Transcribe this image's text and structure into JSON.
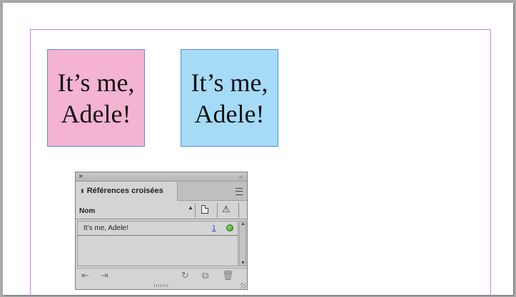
{
  "frames": {
    "pink": {
      "line1": "It’s me,",
      "line2": "Adele!",
      "color": "#f4b3d3"
    },
    "blue": {
      "line1": "It’s me,",
      "line2": "Adele!",
      "color": "#a6dbf7"
    }
  },
  "panel": {
    "close_icon": "×",
    "collapse_icon": "‹‹",
    "tab_label": "Références croisées",
    "tab_arrows": "⬍",
    "columns": {
      "name": "Nom",
      "sort_icon": "▲",
      "page_icon": "page-icon",
      "warning_icon": "⚠"
    },
    "rows": [
      {
        "name": "It’s me, Adele!",
        "page": "1",
        "status": "ok",
        "status_color": "#4caf2a"
      }
    ],
    "scroll": {
      "up": "▲",
      "down": "▼"
    },
    "bottom_icons": {
      "goto_source": "⇤",
      "goto_destination": "⇥",
      "update": "↻",
      "new": "⧉",
      "delete": "🗑"
    }
  }
}
